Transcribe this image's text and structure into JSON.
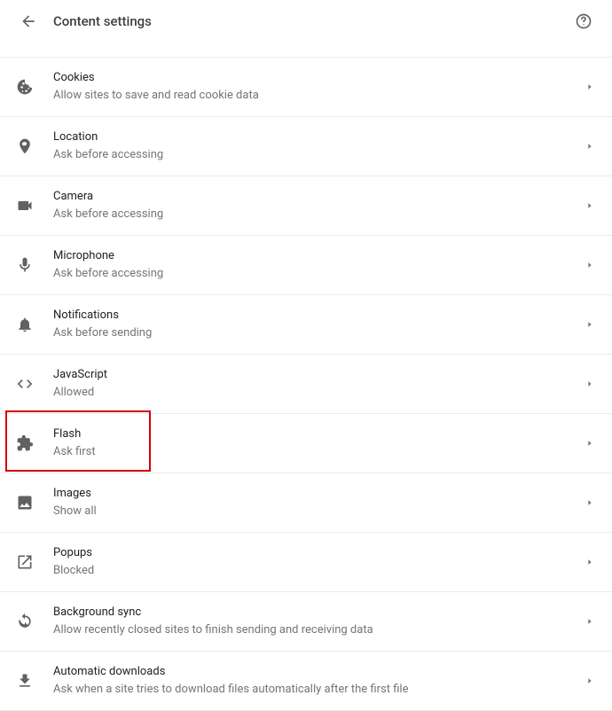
{
  "header": {
    "title": "Content settings"
  },
  "items": [
    {
      "key": "cookies",
      "title": "Cookies",
      "subtitle": "Allow sites to save and read cookie data"
    },
    {
      "key": "location",
      "title": "Location",
      "subtitle": "Ask before accessing"
    },
    {
      "key": "camera",
      "title": "Camera",
      "subtitle": "Ask before accessing"
    },
    {
      "key": "microphone",
      "title": "Microphone",
      "subtitle": "Ask before accessing"
    },
    {
      "key": "notifications",
      "title": "Notifications",
      "subtitle": "Ask before sending"
    },
    {
      "key": "javascript",
      "title": "JavaScript",
      "subtitle": "Allowed"
    },
    {
      "key": "flash",
      "title": "Flash",
      "subtitle": "Ask first"
    },
    {
      "key": "images",
      "title": "Images",
      "subtitle": "Show all"
    },
    {
      "key": "popups",
      "title": "Popups",
      "subtitle": "Blocked"
    },
    {
      "key": "background-sync",
      "title": "Background sync",
      "subtitle": "Allow recently closed sites to finish sending and receiving data"
    },
    {
      "key": "automatic-downloads",
      "title": "Automatic downloads",
      "subtitle": "Ask when a site tries to download files automatically after the first file"
    }
  ],
  "highlight": {
    "index": 6
  }
}
